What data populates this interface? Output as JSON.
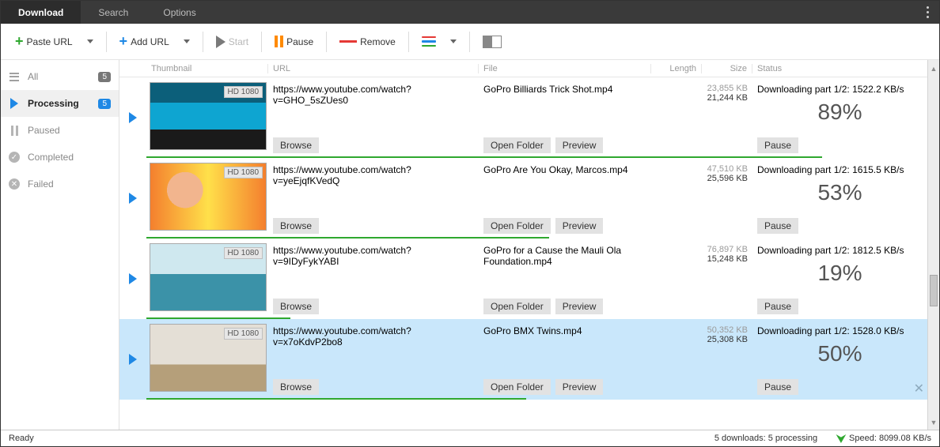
{
  "tabs": {
    "download": "Download",
    "search": "Search",
    "options": "Options"
  },
  "toolbar": {
    "paste_url": "Paste URL",
    "add_url": "Add URL",
    "start": "Start",
    "pause": "Pause",
    "remove": "Remove"
  },
  "sidebar": {
    "items": [
      {
        "label": "All",
        "badge": "5"
      },
      {
        "label": "Processing",
        "badge": "5"
      },
      {
        "label": "Paused"
      },
      {
        "label": "Completed"
      },
      {
        "label": "Failed"
      }
    ]
  },
  "columns": {
    "thumbnail": "Thumbnail",
    "url": "URL",
    "file": "File",
    "length": "Length",
    "size": "Size",
    "status": "Status"
  },
  "buttons": {
    "browse": "Browse",
    "open_folder": "Open Folder",
    "preview": "Preview",
    "pause": "Pause"
  },
  "rows": [
    {
      "badge": "HD 1080",
      "url": "https://www.youtube.com/watch?v=GHO_5sZUes0",
      "file": "GoPro  Billiards Trick Shot.mp4",
      "size_total": "23,855 KB",
      "size_done": "21,244 KB",
      "status": "Downloading part 1/2: 1522.2 KB/s",
      "percent": "89%",
      "progress": 89
    },
    {
      "badge": "HD 1080",
      "url": "https://www.youtube.com/watch?v=yeEjqfKVedQ",
      "file": "GoPro  Are You Okay, Marcos.mp4",
      "size_total": "47,510 KB",
      "size_done": "25,596 KB",
      "status": "Downloading part 1/2: 1615.5 KB/s",
      "percent": "53%",
      "progress": 53
    },
    {
      "badge": "HD 1080",
      "url": "https://www.youtube.com/watch?v=9IDyFykYABI",
      "file": "GoPro for a Cause  the Mauli Ola Foundation.mp4",
      "size_total": "76,897 KB",
      "size_done": "15,248 KB",
      "status": "Downloading part 1/2: 1812.5 KB/s",
      "percent": "19%",
      "progress": 19
    },
    {
      "badge": "HD 1080",
      "url": "https://www.youtube.com/watch?v=x7oKdvP2bo8",
      "file": "GoPro  BMX Twins.mp4",
      "size_total": "50,352 KB",
      "size_done": "25,308 KB",
      "status": "Downloading part 1/2: 1528.0 KB/s",
      "percent": "50%",
      "progress": 50
    }
  ],
  "statusbar": {
    "ready": "Ready",
    "downloads": "5 downloads: 5 processing",
    "speed": "Speed: 8099.08 KB/s"
  }
}
